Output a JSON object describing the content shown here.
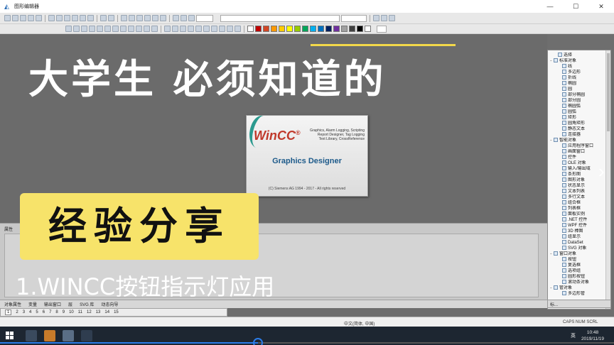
{
  "window": {
    "title": "图形编辑器",
    "controls": [
      "—",
      "☐",
      "✕"
    ]
  },
  "overlay": {
    "headline": "大学生 必须知道的",
    "badge": "经验分享",
    "subtitle": "1.WINCC按钮指示灯应用"
  },
  "splash": {
    "logo": "WinCC",
    "logo_mark": "®",
    "features": "Graphics, Alarm Logging, Scripting\nReport Designer, Tag Logging\nText Library, CrossReference",
    "product": "Graphics Designer",
    "copyright": "(C) Siemens AG 1994 - 2017 - All rights reserved"
  },
  "properties": {
    "title": "属性"
  },
  "palette": {
    "items": [
      {
        "label": "选择",
        "level": 1,
        "toggle": ""
      },
      {
        "label": "标准对象",
        "level": 0,
        "toggle": "−"
      },
      {
        "label": "线",
        "level": 2,
        "toggle": ""
      },
      {
        "label": "多边形",
        "level": 2,
        "toggle": ""
      },
      {
        "label": "折线",
        "level": 2,
        "toggle": ""
      },
      {
        "label": "椭圆",
        "level": 2,
        "toggle": ""
      },
      {
        "label": "圆",
        "level": 2,
        "toggle": ""
      },
      {
        "label": "部分椭圆",
        "level": 2,
        "toggle": ""
      },
      {
        "label": "部分圆",
        "level": 2,
        "toggle": ""
      },
      {
        "label": "椭圆弧",
        "level": 2,
        "toggle": ""
      },
      {
        "label": "圆弧",
        "level": 2,
        "toggle": ""
      },
      {
        "label": "矩形",
        "level": 2,
        "toggle": ""
      },
      {
        "label": "圆角矩形",
        "level": 2,
        "toggle": ""
      },
      {
        "label": "静态文本",
        "level": 2,
        "toggle": ""
      },
      {
        "label": "连接器",
        "level": 2,
        "toggle": ""
      },
      {
        "label": "智能对象",
        "level": 0,
        "toggle": "−"
      },
      {
        "label": "应用程序窗口",
        "level": 2,
        "toggle": ""
      },
      {
        "label": "画面窗口",
        "level": 2,
        "toggle": ""
      },
      {
        "label": "控件",
        "level": 2,
        "toggle": ""
      },
      {
        "label": "OLE 对象",
        "level": 2,
        "toggle": ""
      },
      {
        "label": "输入/输出域",
        "level": 2,
        "toggle": ""
      },
      {
        "label": "条形图",
        "level": 2,
        "toggle": ""
      },
      {
        "label": "图形对象",
        "level": 2,
        "toggle": ""
      },
      {
        "label": "状态显示",
        "level": 2,
        "toggle": ""
      },
      {
        "label": "文本列表",
        "level": 2,
        "toggle": ""
      },
      {
        "label": "多行文本",
        "level": 2,
        "toggle": ""
      },
      {
        "label": "组合框",
        "level": 2,
        "toggle": ""
      },
      {
        "label": "列表框",
        "level": 2,
        "toggle": ""
      },
      {
        "label": "面板实例",
        "level": 2,
        "toggle": ""
      },
      {
        "label": ".NET 控件",
        "level": 2,
        "toggle": ""
      },
      {
        "label": "WPF 控件",
        "level": 2,
        "toggle": ""
      },
      {
        "label": "3D 棒图",
        "level": 2,
        "toggle": ""
      },
      {
        "label": "组显示",
        "level": 2,
        "toggle": ""
      },
      {
        "label": "DataSet",
        "level": 2,
        "toggle": ""
      },
      {
        "label": "SVG 对象",
        "level": 2,
        "toggle": ""
      },
      {
        "label": "窗口对象",
        "level": 0,
        "toggle": "−"
      },
      {
        "label": "按钮",
        "level": 2,
        "toggle": ""
      },
      {
        "label": "复选框",
        "level": 2,
        "toggle": ""
      },
      {
        "label": "选项组",
        "level": 2,
        "toggle": ""
      },
      {
        "label": "圆形按钮",
        "level": 2,
        "toggle": ""
      },
      {
        "label": "滚动条对象",
        "level": 2,
        "toggle": ""
      },
      {
        "label": "管对象",
        "level": 0,
        "toggle": "−"
      },
      {
        "label": "多边形管",
        "level": 2,
        "toggle": ""
      }
    ],
    "bottom_tab": "标..."
  },
  "bottom_tabs": [
    "对象属性",
    "变量",
    "输出窗口",
    "层",
    "SVG 库",
    "动态向导"
  ],
  "page_tabs": [
    "1",
    "2",
    "3",
    "4",
    "5",
    "6",
    "7",
    "8",
    "9",
    "10",
    "11",
    "12",
    "13",
    "14",
    "15"
  ],
  "status": {
    "language": "中文(简体, 中国)",
    "keys": "CAPS NUM SCRL"
  },
  "taskbar": {
    "ime": "英",
    "time": "10:48",
    "date": "2019/11/19"
  },
  "colors": {
    "accent_yellow": "#f7e36a",
    "taskbar": "#1d2631",
    "progress": "#2b7de9",
    "palette": [
      "#ffffff",
      "#c00000",
      "#d24726",
      "#ff9900",
      "#ffcc00",
      "#ffff00",
      "#99cc00",
      "#00a65a",
      "#00b0f0",
      "#0070c0",
      "#002060",
      "#7030a0",
      "#a0a0a0",
      "#404040",
      "#000000",
      "#ffffff"
    ]
  },
  "video": {
    "progress_percent": 42
  }
}
